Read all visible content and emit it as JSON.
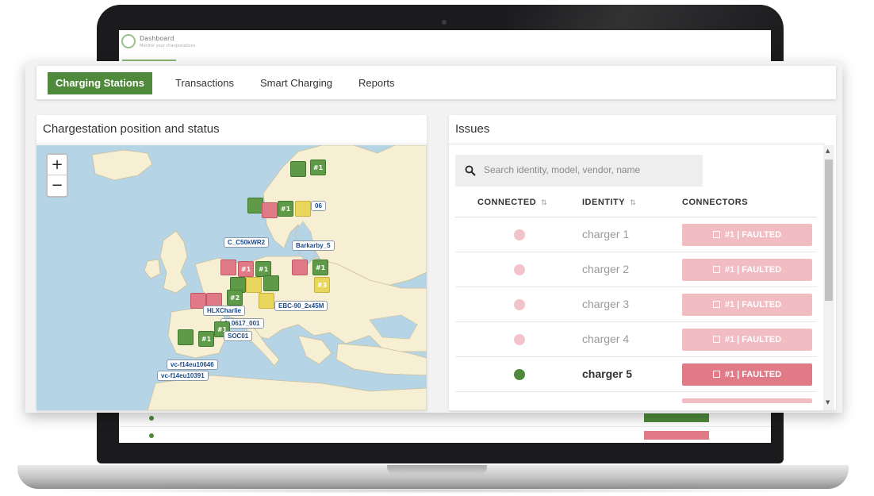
{
  "dashboard": {
    "title": "Dashboard",
    "subtitle": "Monitor your chargestations"
  },
  "nav": {
    "tabs": [
      {
        "label": "Charging Stations",
        "active": true
      },
      {
        "label": "Transactions"
      },
      {
        "label": "Smart Charging"
      },
      {
        "label": "Reports"
      }
    ]
  },
  "map": {
    "title": "Chargestation position and status",
    "zoom_in": "+",
    "zoom_out": "−",
    "markers": [
      {
        "label": "#1",
        "status": "connected"
      },
      {
        "label": "#1",
        "status": "connected"
      },
      {
        "label": "#1",
        "status": "faulted"
      },
      {
        "label": "#1",
        "status": "connected"
      },
      {
        "label": "#1",
        "status": "connected"
      },
      {
        "label": "#2",
        "status": "warning"
      },
      {
        "label": "#3",
        "status": "warning"
      },
      {
        "label": "#1",
        "status": "connected"
      },
      {
        "label": "#1",
        "status": "connected"
      },
      {
        "label": "#1",
        "status": "connected"
      }
    ],
    "labels": [
      "06",
      "C_C50kWR2",
      "Barkarby_5",
      "EBC-90_2x45M",
      "HLXCharlie",
      "1_0617_001",
      "SOC01",
      "vc-f14eu10646",
      "vc-f14eu10391"
    ]
  },
  "issues": {
    "title": "Issues",
    "search_placeholder": "Search identity, model, vendor, name",
    "columns": {
      "connected": "CONNECTED",
      "identity": "IDENTITY",
      "connectors": "CONNECTORS"
    },
    "rows": [
      {
        "identity": "charger 1",
        "connected": false,
        "connector": "#1 | FAULTED"
      },
      {
        "identity": "charger 2",
        "connected": false,
        "connector": "#1 | FAULTED"
      },
      {
        "identity": "charger 3",
        "connected": false,
        "connector": "#1 | FAULTED"
      },
      {
        "identity": "charger 4",
        "connected": false,
        "connector": "#1 | FAULTED"
      },
      {
        "identity": "charger 5",
        "connected": true,
        "connector": "#1 | FAULTED"
      }
    ]
  },
  "colors": {
    "accent": "#4f8a3c",
    "connected": "#4f8a3c",
    "disconnected": "#f2c4c9",
    "faulted": "#e07a86",
    "faulted_muted": "#f2bcc3",
    "warning": "#e9d65c"
  }
}
